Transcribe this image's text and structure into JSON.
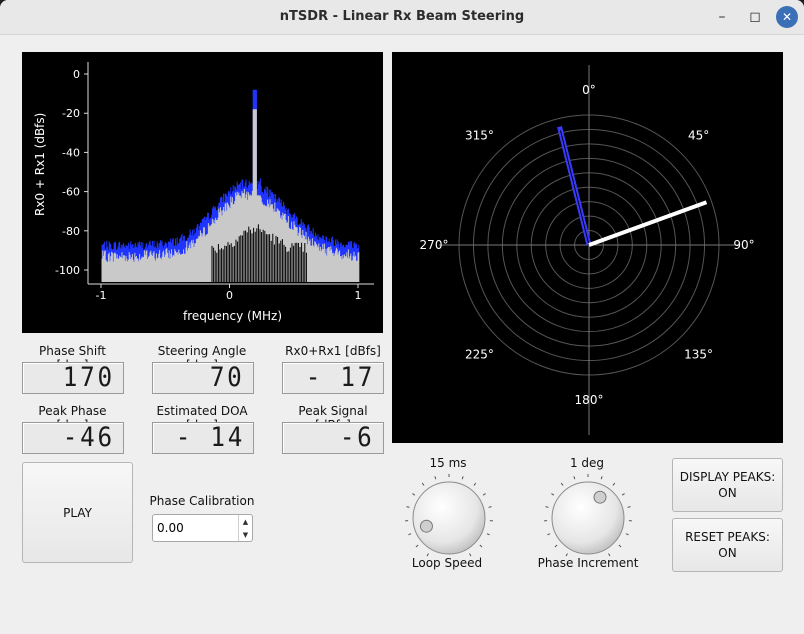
{
  "window": {
    "title": "nTSDR - Linear Rx Beam Steering",
    "minimize": "–",
    "maximize": "◻",
    "close": "✕"
  },
  "spectrum": {
    "ylabel": "Rx0 + Rx1 (dBfs)",
    "xlabel": "frequency (MHz)",
    "yticks": [
      "0",
      "-20",
      "-40",
      "-60",
      "-80",
      "-100"
    ],
    "xticks": [
      "-1",
      "0",
      "1"
    ],
    "colors": {
      "peak_hold": "#1f35ff",
      "trace": "#c9c9c9",
      "floor": "#000000"
    }
  },
  "polar": {
    "angle_labels": [
      "0°",
      "45°",
      "90°",
      "135°",
      "180°",
      "225°",
      "270°",
      "315°"
    ],
    "peak_angle_deg": -14,
    "steer_angle_deg": 70,
    "colors": {
      "peak": "#3a3aff",
      "steer": "#ffffff"
    }
  },
  "readouts": [
    {
      "label": "Phase Shift [deg]",
      "value": "170"
    },
    {
      "label": "Steering Angle [deg]",
      "value": "70"
    },
    {
      "label": "Rx0+Rx1 [dBfs]",
      "value": "- 17"
    },
    {
      "label": "Peak Phase [deg]",
      "value": "-46"
    },
    {
      "label": "Estimated DOA [deg]",
      "value": "- 14"
    },
    {
      "label": "Peak Signal [dBfs]",
      "value": "-6"
    }
  ],
  "play_label": "PLAY",
  "calibration": {
    "label": "Phase Calibration",
    "value": "0.00"
  },
  "loop_speed": {
    "value": "15 ms",
    "label": "Loop Speed"
  },
  "phase_increment": {
    "value": "1 deg",
    "label": "Phase Increment"
  },
  "display_peaks": {
    "line1": "DISPLAY PEAKS:",
    "line2": "ON"
  },
  "reset_peaks": {
    "line1": "RESET PEAKS:",
    "line2": "ON"
  }
}
